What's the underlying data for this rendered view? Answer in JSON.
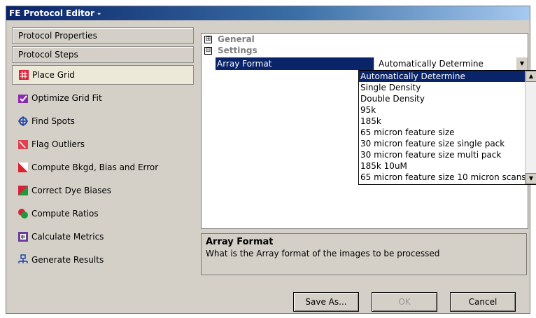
{
  "window": {
    "title": "FE Protocol Editor -"
  },
  "left_panel": {
    "sections": [
      {
        "label": "Protocol Properties"
      },
      {
        "label": "Protocol Steps"
      }
    ],
    "steps": [
      {
        "label": "Place Grid",
        "icon": "place-grid-icon",
        "selected": true
      },
      {
        "label": "Optimize Grid Fit",
        "icon": "optimize-grid-fit-icon"
      },
      {
        "label": "Find Spots",
        "icon": "find-spots-icon"
      },
      {
        "label": "Flag Outliers",
        "icon": "flag-outliers-icon"
      },
      {
        "label": "Compute Bkgd, Bias and Error",
        "icon": "compute-bkgd-icon"
      },
      {
        "label": "Correct Dye Biases",
        "icon": "correct-dye-biases-icon"
      },
      {
        "label": "Compute Ratios",
        "icon": "compute-ratios-icon"
      },
      {
        "label": "Calculate Metrics",
        "icon": "calculate-metrics-icon"
      },
      {
        "label": "Generate Results",
        "icon": "generate-results-icon"
      }
    ]
  },
  "property_grid": {
    "categories": [
      {
        "label": "General",
        "expander": "⊞"
      },
      {
        "label": "Settings",
        "expander": "⊟"
      }
    ],
    "selected_property": {
      "name": "Array Format",
      "value": "Automatically Determine"
    },
    "dropdown_options": [
      "Automatically Determine",
      "Single Density",
      "Double Density",
      "95k",
      "185k",
      "65 micron feature size",
      "30 micron feature size single pack",
      "30 micron feature size multi pack",
      "185k 10uM",
      "65 micron feature size 10 micron scans"
    ],
    "highlighted_option": "Automatically Determine"
  },
  "description": {
    "title": "Array Format",
    "text": "What is the Array format of the images to be processed"
  },
  "buttons": {
    "save_as": "Save As...",
    "ok": "OK",
    "cancel": "Cancel"
  },
  "colors": {
    "titlebar": "#0a246a",
    "selection": "#0a246a",
    "window_bg": "#d4d0c8"
  }
}
